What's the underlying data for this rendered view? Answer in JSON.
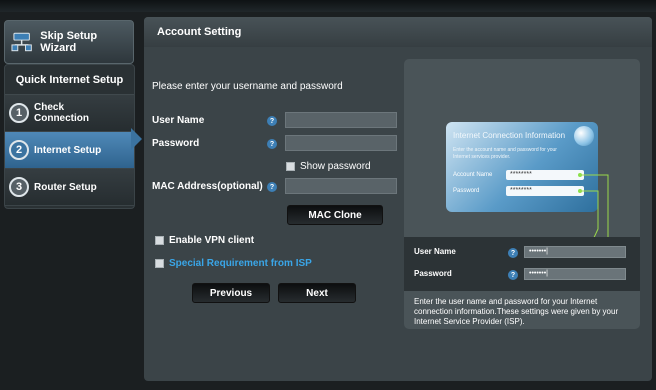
{
  "sidebar": {
    "skip_label": "Skip Setup Wizard",
    "panel_title": "Quick Internet Setup",
    "steps": [
      {
        "num": "1",
        "label_line1": "Check",
        "label_line2": "Connection"
      },
      {
        "num": "2",
        "label_line1": "Internet Setup",
        "label_line2": ""
      },
      {
        "num": "3",
        "label_line1": "Router Setup",
        "label_line2": ""
      }
    ]
  },
  "main": {
    "title": "Account Setting",
    "prompt": "Please enter your username and password",
    "user_name_label": "User Name",
    "password_label": "Password",
    "show_password_label": "Show password",
    "mac_label": "MAC Address(optional)",
    "mac_clone_label": "MAC Clone",
    "vpn_label": "Enable VPN client",
    "isp_label": "Special Requirement from ISP",
    "previous_label": "Previous",
    "next_label": "Next",
    "help_glyph": "?",
    "user_name_value": "",
    "password_value": "",
    "mac_value": ""
  },
  "illustration": {
    "card_title": "Internet Connection Information",
    "card_desc": "Enter the account name and password for your Internet services provider.",
    "account_name_label": "Account Name",
    "password_label": "Password",
    "masked": "********",
    "lower_user": "User Name",
    "lower_password": "Password",
    "lower_masked": "•••••••|",
    "help_text": "Enter the user name and password for your Internet connection information.These settings were given by your Internet Service Provider (ISP)."
  },
  "colors": {
    "accent_blue": "#3d7fb5",
    "link_blue": "#3aa6e8",
    "panel_bg": "#3b4448"
  }
}
